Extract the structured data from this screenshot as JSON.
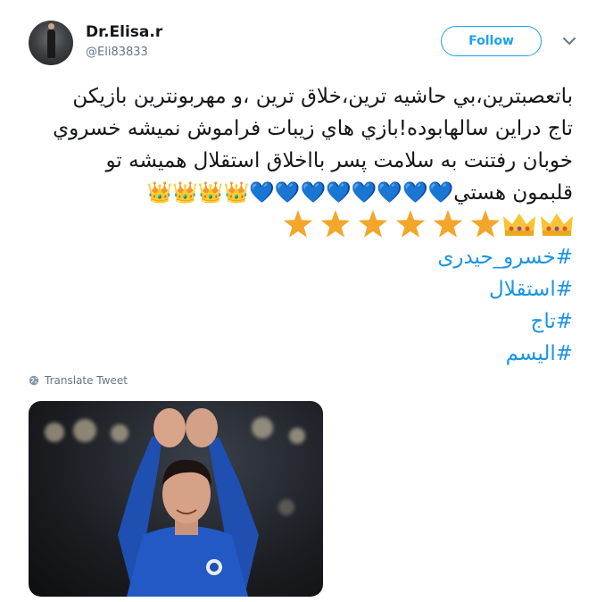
{
  "user": {
    "display_name": "Dr.Elisa.r",
    "handle": "@Eli83833"
  },
  "actions": {
    "follow_label": "Follow",
    "menu_icon": "chevron-down-icon"
  },
  "tweet": {
    "lines": [
      "باتعصبترین،بي حاشيه ترين،خلاق ترين ،و مهربونترين بازيكن",
      "تاج دراين سالهابوده!بازي هاي زيبات فراموش نميشه خسروي",
      "خوبان رفتنت به سلامت پسر بااخلاق استقلال هميشه تو",
      "قلبمون هستي💙💙💙💙💙💙💙💙👑👑👑👑"
    ],
    "last_line_suffix": "👑👑⭐⭐⭐⭐⭐⭐⭐",
    "hashtags": [
      "#خسرو_حیدری",
      "#استقلال",
      "#تاج",
      "#الیسم"
    ]
  },
  "translate": {
    "label": "Translate Tweet",
    "icon": "globe-icon"
  },
  "media": {
    "type": "photo",
    "subject": "football player in blue kit clapping overhead"
  },
  "colors": {
    "link": "#1b95e0",
    "follow_border": "#1da1f2",
    "secondary_text": "#657786",
    "heart": "#5dadec",
    "star": "#f4a62a",
    "crown": "#f7c533"
  }
}
